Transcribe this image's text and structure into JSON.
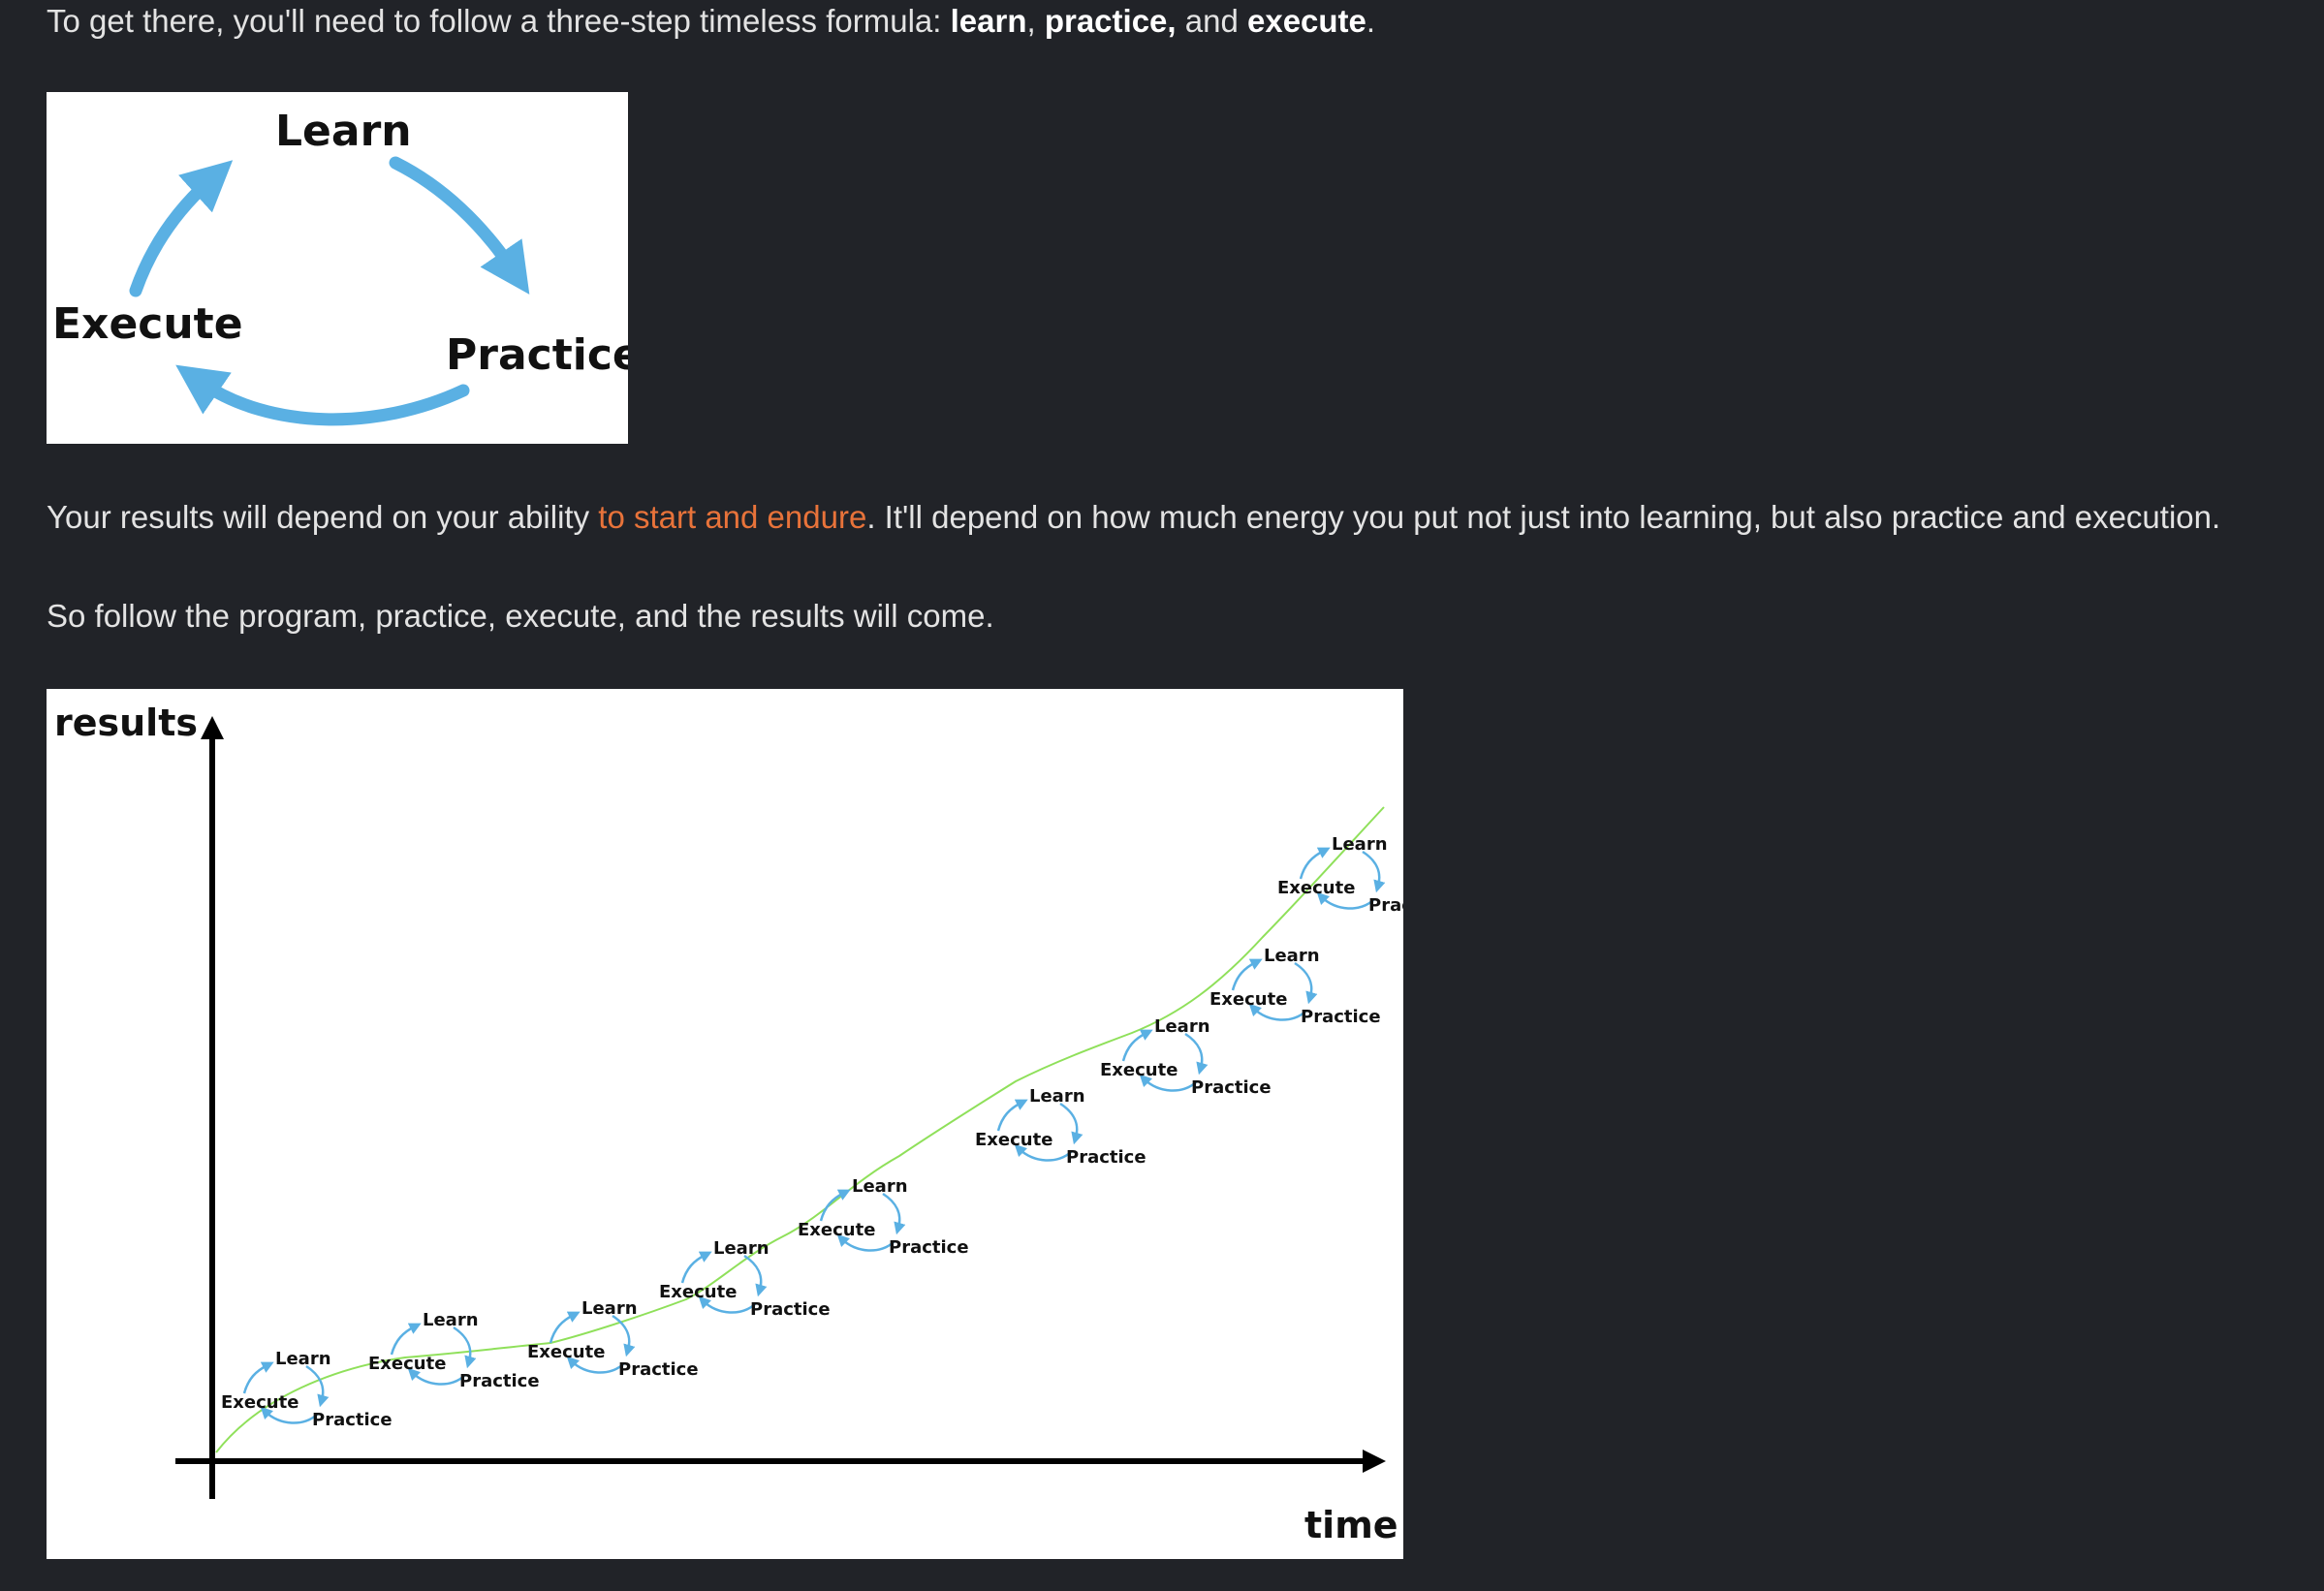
{
  "intro": {
    "prefix": "To get there, you'll need to follow a three-step timeless formula: ",
    "learn": "learn",
    "sep1": ", ",
    "practice": "practice,",
    "sep2": " and ",
    "execute": "execute",
    "suffix": "."
  },
  "cycle_diagram": {
    "learn": "Learn",
    "practice": "Practice",
    "execute": "Execute"
  },
  "results_para": {
    "prefix": "Your results will depend on your ability ",
    "link": "to start and endure",
    "suffix": ". It'll depend on how much energy you put not just into learning, but also practice and execution."
  },
  "follow_para": {
    "text": "So follow the program, practice, execute, and the results will come."
  },
  "growth_diagram": {
    "y_label": "results",
    "x_label": "time",
    "step_labels": {
      "learn": "Learn",
      "practice": "Practice",
      "execute": "Execute"
    },
    "cycle_count": 9,
    "colors": {
      "arrows": "#5ab0e3",
      "trend": "#8fe05a",
      "axes": "#000000"
    }
  },
  "colors": {
    "background": "#212328",
    "text": "#e3e3e3",
    "link": "#e8733a"
  }
}
